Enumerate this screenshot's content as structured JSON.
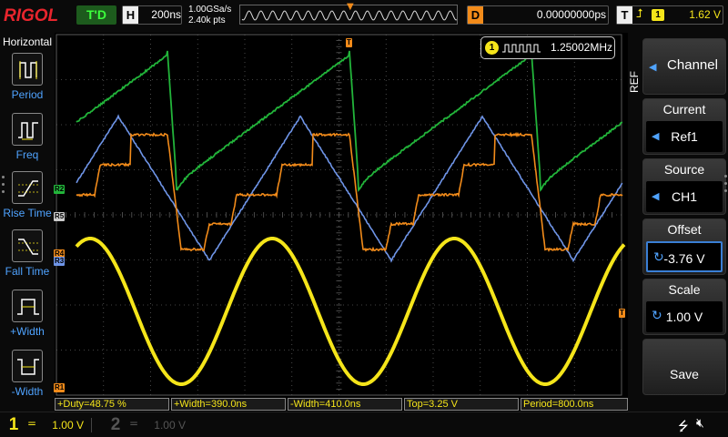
{
  "header": {
    "logo": "RIGOL",
    "trigger_status": "T'D",
    "timebase_label": "H",
    "timebase_value": "200ns",
    "sample_rate": "1.00GSa/s",
    "memory_depth": "2.40k pts",
    "delay_label": "D",
    "delay_value": "0.00000000ps",
    "trigger_label": "T",
    "trigger_edge_icon": "rising-edge-icon",
    "trigger_source": "1",
    "trigger_level": "1.62 V"
  },
  "left_menu": {
    "title": "Horizontal",
    "items": [
      {
        "label": "Period",
        "icon": "period-icon"
      },
      {
        "label": "Freq",
        "icon": "freq-icon"
      },
      {
        "label": "Rise Time",
        "icon": "rise-time-icon"
      },
      {
        "label": "Fall Time",
        "icon": "fall-time-icon"
      },
      {
        "label": "+Width",
        "icon": "pos-width-icon"
      },
      {
        "label": "-Width",
        "icon": "neg-width-icon"
      }
    ]
  },
  "freq_counter": {
    "source": "1",
    "value": "1.25002MHz"
  },
  "trace_labels": {
    "r2": "R2",
    "r5": "R5",
    "r4": "R4",
    "r3": "R3",
    "r1": "R1",
    "trigger_marker": "T"
  },
  "measurements": [
    "+Duty=48.75 %",
    "+Width=390.0ns",
    "-Width=410.0ns",
    "Top=3.25 V",
    "Period=800.0ns"
  ],
  "right_menu": {
    "title": "REF",
    "buttons": [
      {
        "head": "",
        "value": "Channel"
      },
      {
        "head": "Current",
        "value": "Ref1"
      },
      {
        "head": "Source",
        "value": "CH1"
      },
      {
        "head": "Offset",
        "value": "-3.76 V"
      },
      {
        "head": "Scale",
        "value": "1.00 V"
      },
      {
        "head": "",
        "value": "Save"
      }
    ]
  },
  "channels": [
    {
      "number": "1",
      "coupling": "=",
      "scale": "1.00 V",
      "color": "#f5e51a"
    },
    {
      "number": "2",
      "coupling": "=",
      "scale": "1.00 V",
      "color": "#555555"
    }
  ],
  "status_icons": [
    "usb-icon",
    "speaker-muted-icon"
  ],
  "colors": {
    "ch1": "#f5e51a",
    "ref_green": "#22b43a",
    "ref_blue": "#6f95e8",
    "ref_orange": "#f28b1a",
    "grid": "#5a5a5a"
  }
}
